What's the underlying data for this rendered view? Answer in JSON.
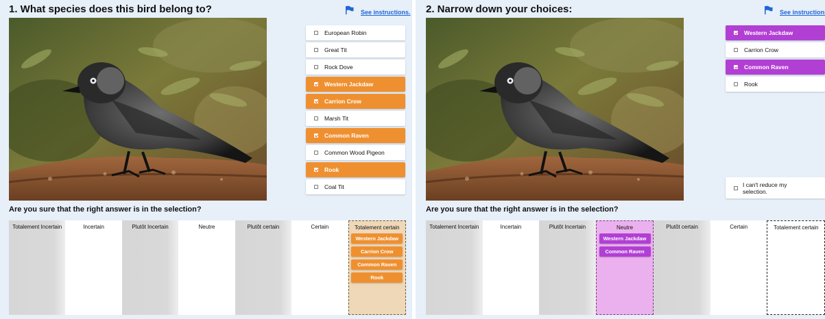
{
  "left": {
    "title": "1. What species does this bird belong to?",
    "instructions_link": "See instructions.",
    "options": [
      {
        "label": "European Robin",
        "selected": false
      },
      {
        "label": "Great Tit",
        "selected": false
      },
      {
        "label": "Rock Dove",
        "selected": false
      },
      {
        "label": "Western Jackdaw",
        "selected": true
      },
      {
        "label": "Carrion Crow",
        "selected": true
      },
      {
        "label": "Marsh Tit",
        "selected": false
      },
      {
        "label": "Common Raven",
        "selected": true
      },
      {
        "label": "Common Wood Pigeon",
        "selected": false
      },
      {
        "label": "Rook",
        "selected": true
      },
      {
        "label": "Coal Tit",
        "selected": false
      }
    ],
    "question": "Are you sure that the right answer is in the selection?",
    "scale": [
      "Totalement Incertain",
      "Incertain",
      "Plutôt Incertain",
      "Neutre",
      "Plutôt certain",
      "Certain",
      "Totalement certain"
    ],
    "placed_chips": [
      "Western Jackdaw",
      "Carrion Crow",
      "Common Raven",
      "Rook"
    ],
    "accent_color": "#ef9030"
  },
  "right": {
    "title": "2. Narrow down your choices:",
    "instructions_link": "See instructions.",
    "options": [
      {
        "label": "Western Jackdaw",
        "selected": true
      },
      {
        "label": "Carrion Crow",
        "selected": false
      },
      {
        "label": "Common Raven",
        "selected": true
      },
      {
        "label": "Rook",
        "selected": false
      }
    ],
    "cant_reduce": "I can't reduce my selection.",
    "question": "Are you sure that the right answer is in the selection?",
    "scale": [
      "Totalement Incertain",
      "Incertain",
      "Plutôt Incertain",
      "Neutre",
      "Plutôt certain",
      "Certain",
      "Totalement certain"
    ],
    "placed_chips": [
      "Western Jackdaw",
      "Common Raven"
    ],
    "accent_color": "#b13fd4"
  }
}
